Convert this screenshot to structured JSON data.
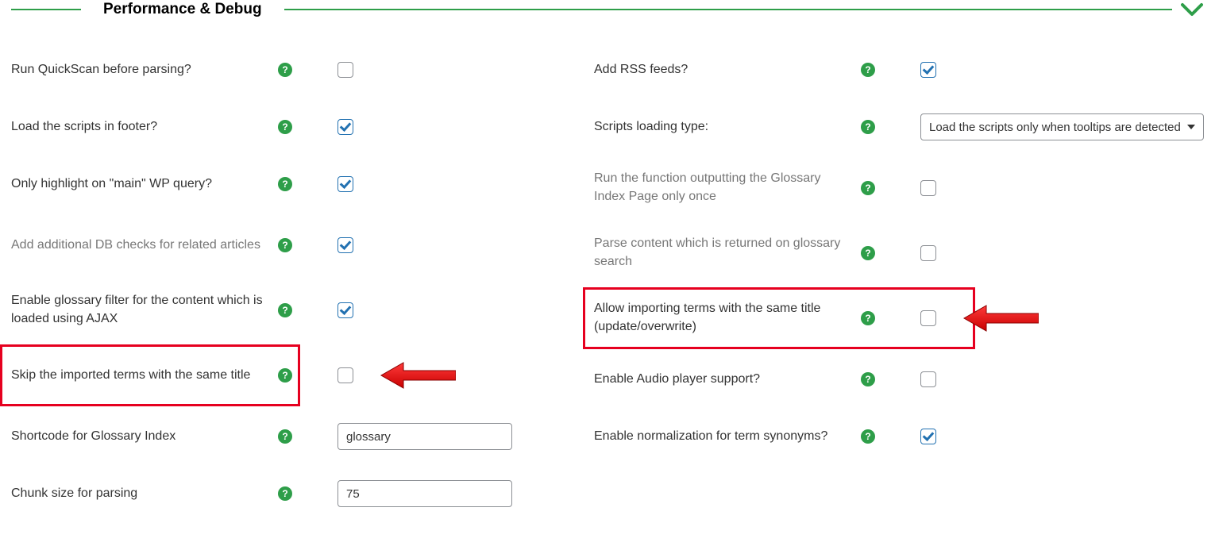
{
  "section_title": "Performance & Debug",
  "left": [
    {
      "id": "quickscan",
      "label": "Run QuickScan before parsing?",
      "type": "checkbox",
      "checked": false,
      "highlighted": false,
      "dim": false,
      "arrow": false
    },
    {
      "id": "footer-scripts",
      "label": "Load the scripts in footer?",
      "type": "checkbox",
      "checked": true,
      "highlighted": false,
      "dim": false,
      "arrow": false
    },
    {
      "id": "main-query",
      "label": "Only highlight on \"main\" WP query?",
      "type": "checkbox",
      "checked": true,
      "highlighted": false,
      "dim": false,
      "arrow": false
    },
    {
      "id": "db-checks",
      "label": "Add additional DB checks for related articles",
      "type": "checkbox",
      "checked": true,
      "highlighted": false,
      "dim": true,
      "arrow": false
    },
    {
      "id": "ajax-filter",
      "label": "Enable glossary filter for the content which is loaded using AJAX",
      "type": "checkbox",
      "checked": true,
      "highlighted": false,
      "dim": false,
      "arrow": false
    },
    {
      "id": "skip-imported",
      "label": "Skip the imported terms with the same title",
      "type": "checkbox",
      "checked": false,
      "highlighted": true,
      "dim": false,
      "arrow": true
    },
    {
      "id": "shortcode",
      "label": "Shortcode for Glossary Index",
      "type": "text",
      "value": "glossary",
      "highlighted": false,
      "dim": false,
      "arrow": false
    },
    {
      "id": "chunk-size",
      "label": "Chunk size for parsing",
      "type": "text",
      "value": "75",
      "highlighted": false,
      "dim": false,
      "arrow": false
    }
  ],
  "right": [
    {
      "id": "rss",
      "label": "Add RSS feeds?",
      "type": "checkbox",
      "checked": true,
      "highlighted": false,
      "dim": false,
      "arrow": false
    },
    {
      "id": "scripts-type",
      "label": "Scripts loading type:",
      "type": "select",
      "value": "Load the scripts only when tooltips are detected",
      "highlighted": false,
      "dim": false,
      "arrow": false
    },
    {
      "id": "output-once",
      "label": "Run the function outputting the Glossary Index Page only once",
      "type": "checkbox",
      "checked": false,
      "highlighted": false,
      "dim": true,
      "arrow": false
    },
    {
      "id": "parse-search",
      "label": "Parse content which is returned on glossary search",
      "type": "checkbox",
      "checked": false,
      "highlighted": false,
      "dim": true,
      "arrow": false
    },
    {
      "id": "allow-import",
      "label": "Allow importing terms with the same title (update/overwrite)",
      "type": "checkbox",
      "checked": false,
      "highlighted": true,
      "dim": false,
      "arrow": true
    },
    {
      "id": "audio",
      "label": "Enable Audio player support?",
      "type": "checkbox",
      "checked": false,
      "highlighted": false,
      "dim": false,
      "arrow": false
    },
    {
      "id": "normalize",
      "label": "Enable normalization for term synonyms?",
      "type": "checkbox",
      "checked": true,
      "highlighted": false,
      "dim": false,
      "arrow": false
    }
  ]
}
